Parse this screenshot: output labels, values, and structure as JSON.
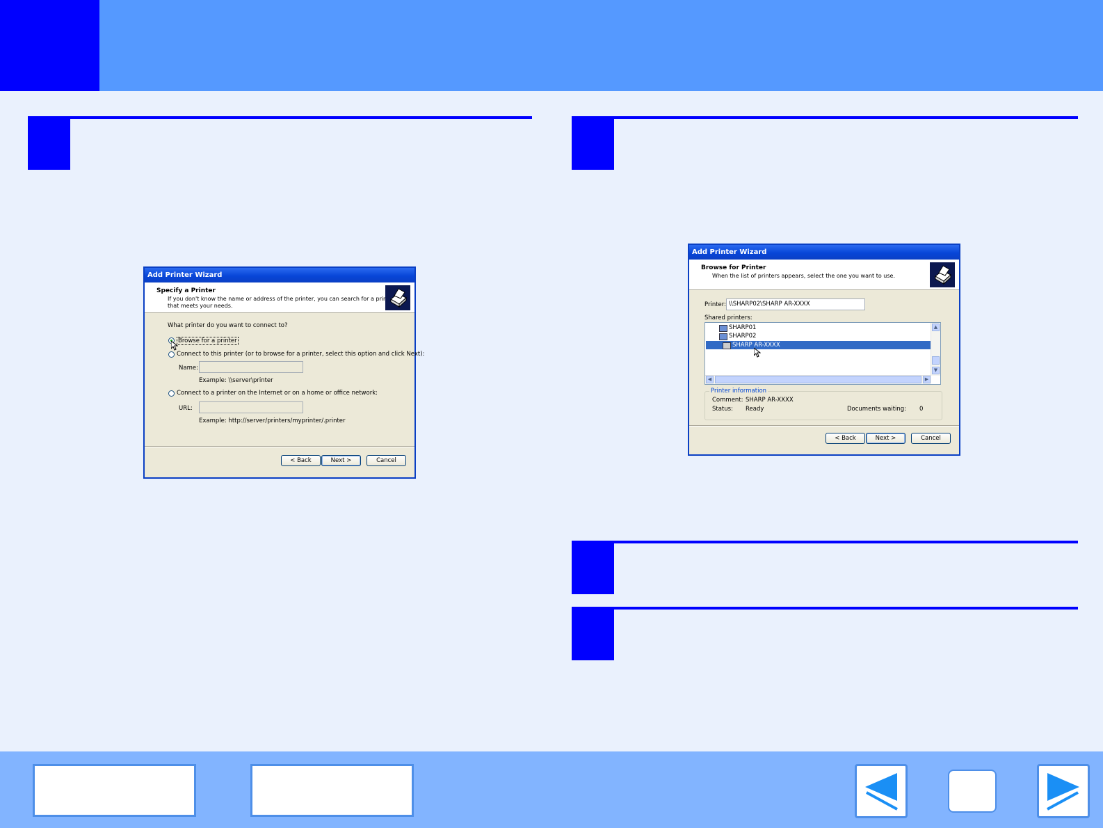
{
  "dialog_left": {
    "title": "Add Printer Wizard",
    "heading": "Specify a Printer",
    "subtitle_line1": "If you don't know the name or address of the printer, you can search for a printer",
    "subtitle_line2": "that meets your needs.",
    "question": "What printer do you want to connect to?",
    "option_browse": "Browse for a printer",
    "option_connect": "Connect to this printer (or to browse for a printer, select this option and click Next):",
    "name_label": "Name:",
    "name_example": "Example: \\\\server\\printer",
    "option_internet": "Connect to a printer on the Internet or on a home or office network:",
    "url_label": "URL:",
    "url_example": "Example: http://server/printers/myprinter/.printer",
    "back": "< Back",
    "next": "Next >",
    "cancel": "Cancel"
  },
  "dialog_right": {
    "title": "Add Printer Wizard",
    "heading": "Browse for Printer",
    "subtitle": "When the list of printers appears, select the one you want to use.",
    "printer_label": "Printer:",
    "printer_value": "\\\\SHARP02\\SHARP AR-XXXX",
    "shared_label": "Shared printers:",
    "tree": [
      "SHARP01",
      "SHARP02",
      "SHARP AR-XXXX"
    ],
    "info_group": "Printer information",
    "comment_label": "Comment:",
    "comment_value": "SHARP AR-XXXX",
    "status_label": "Status:",
    "status_value": "Ready",
    "docs_label": "Documents waiting:",
    "docs_value": "0",
    "back": "< Back",
    "next": "Next >",
    "cancel": "Cancel"
  },
  "colors": {
    "header": "#5599ff",
    "accent": "#0000ff",
    "background": "#eaf1fd",
    "footer": "#82b4ff"
  },
  "icons": [
    "printer-icon",
    "left-arrow-icon",
    "right-arrow-icon",
    "mouse-cursor-icon"
  ]
}
